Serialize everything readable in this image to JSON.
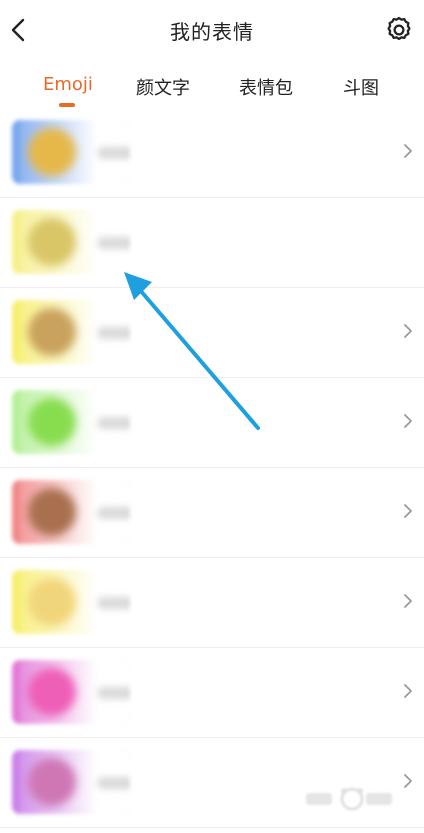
{
  "header": {
    "title": "我的表情"
  },
  "tabs": [
    {
      "label": "Emoji",
      "active": true
    },
    {
      "label": "颜文字",
      "active": false
    },
    {
      "label": "表情包",
      "active": false
    },
    {
      "label": "斗图",
      "active": false
    }
  ],
  "colors": {
    "accent": "#e86a2b",
    "annotation_arrow": "#1ea0e0"
  },
  "icons": {
    "back": "chevron-left-icon",
    "settings": "gear-icon",
    "row_chevron": "chevron-right-icon"
  },
  "rows": [
    {
      "color": "#7aa7ee",
      "blob": "#e6b84a",
      "has_chevron": true
    },
    {
      "color": "#f6f08a",
      "blob": "#d9c667",
      "has_chevron": false
    },
    {
      "color": "#f7ef70",
      "blob": "#c9a25d",
      "has_chevron": true
    },
    {
      "color": "#b6f09a",
      "blob": "#88dd4f",
      "has_chevron": true
    },
    {
      "color": "#f28a8a",
      "blob": "#a9704f",
      "has_chevron": true
    },
    {
      "color": "#f7ef70",
      "blob": "#f1d57a",
      "has_chevron": true
    },
    {
      "color": "#e27ad8",
      "blob": "#ee5fb7",
      "has_chevron": true
    },
    {
      "color": "#cc82e8",
      "blob": "#cf77b5",
      "has_chevron": true
    }
  ]
}
